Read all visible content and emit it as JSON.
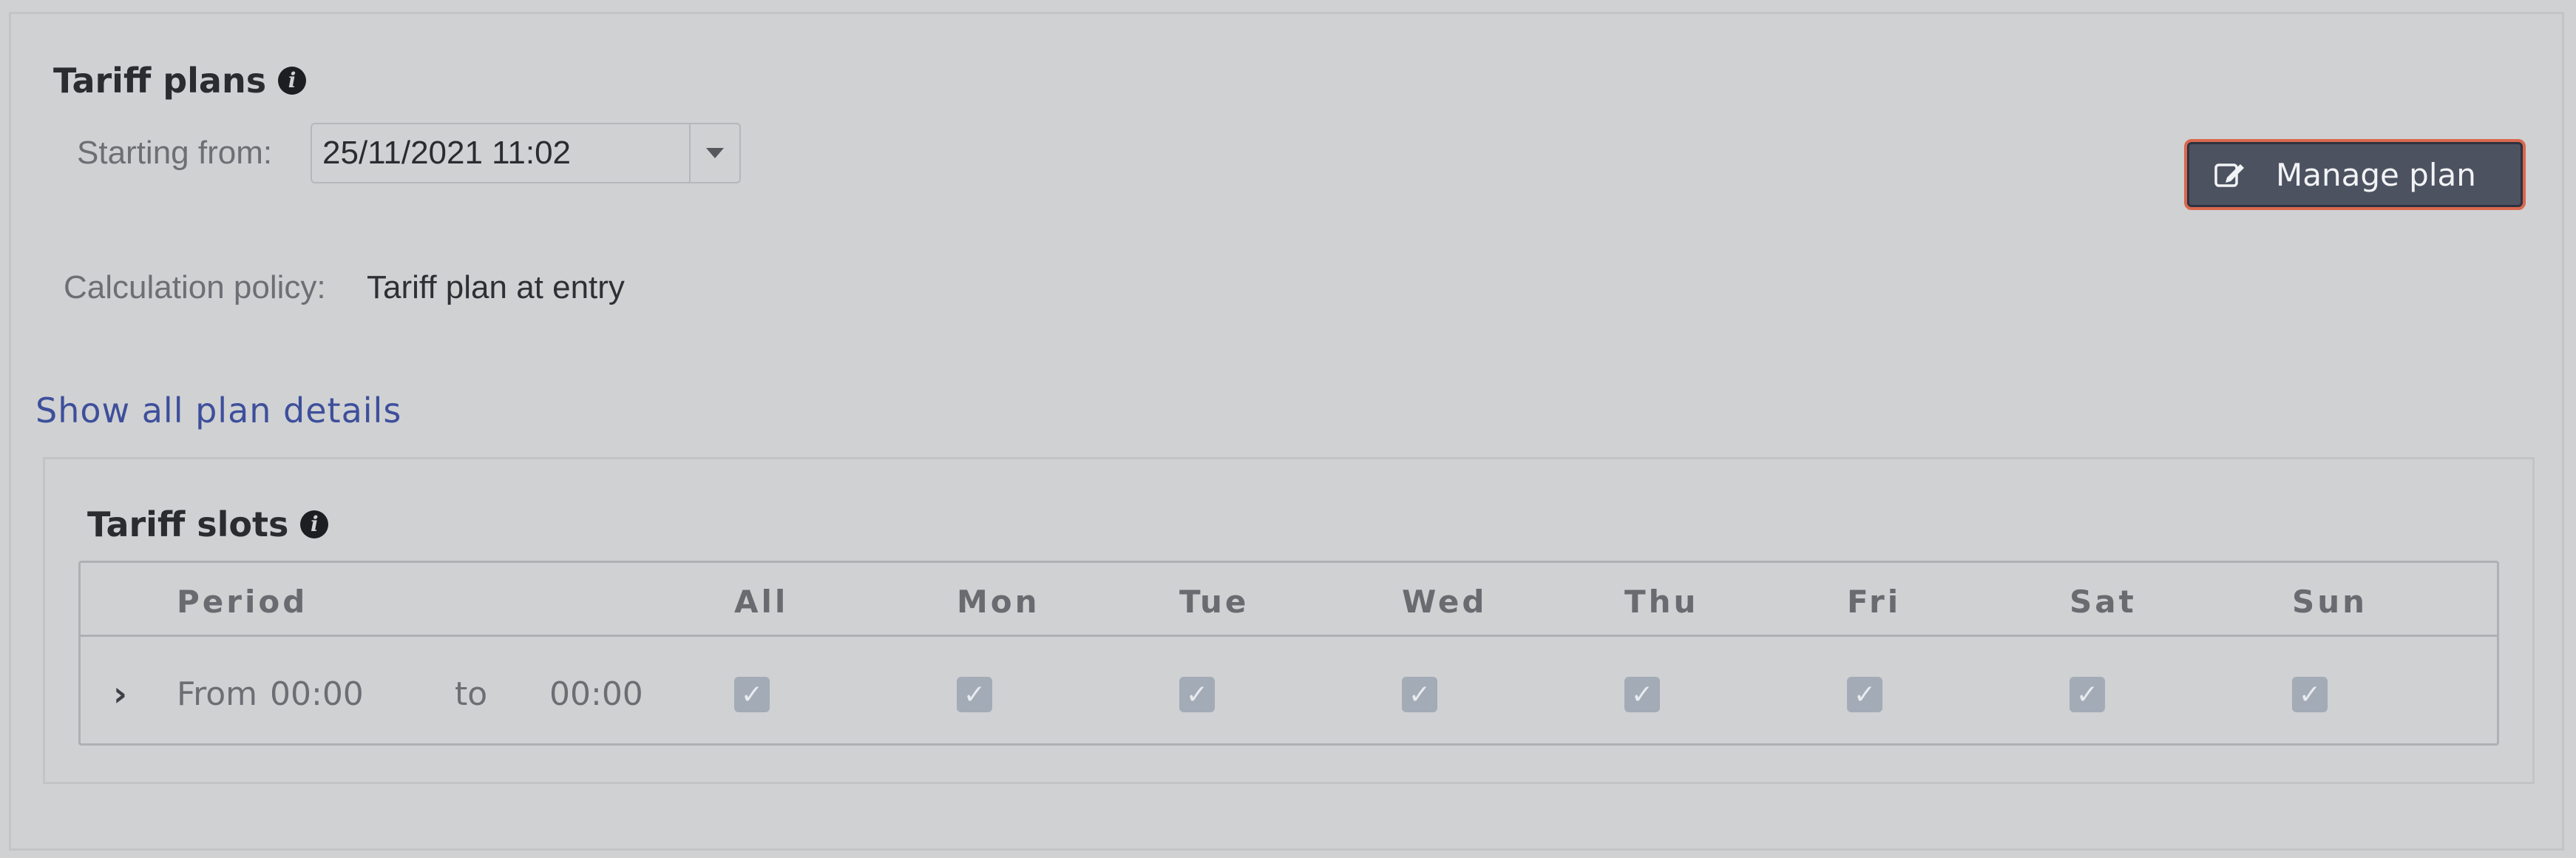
{
  "tariff_plans": {
    "title": "Tariff plans",
    "info_icon": "info-circle-icon",
    "starting_from_label": "Starting from:",
    "starting_from_value": "25/11/2021 11:02",
    "calculation_policy_label": "Calculation policy:",
    "calculation_policy_value": "Tariff plan at entry",
    "manage_button": {
      "label": "Manage plan",
      "icon": "edit-icon"
    },
    "show_details_link": "Show all plan details"
  },
  "tariff_slots": {
    "title": "Tariff slots",
    "info_icon": "info-circle-icon",
    "columns": [
      "Period",
      "All",
      "Mon",
      "Tue",
      "Wed",
      "Thu",
      "Fri",
      "Sat",
      "Sun"
    ],
    "rows": [
      {
        "from_label": "From",
        "from_time": "00:00",
        "to_label": "to",
        "to_time": "00:00",
        "checks": {
          "All": true,
          "Mon": true,
          "Tue": true,
          "Wed": true,
          "Thu": true,
          "Fri": true,
          "Sat": true,
          "Sun": true
        }
      }
    ]
  },
  "colors": {
    "background": "#d0d1d3",
    "button_bg": "#4d5261",
    "button_focus_outline": "#d9684e",
    "link": "#3d4f9b",
    "checkbox_disabled": "#a3abb7"
  }
}
